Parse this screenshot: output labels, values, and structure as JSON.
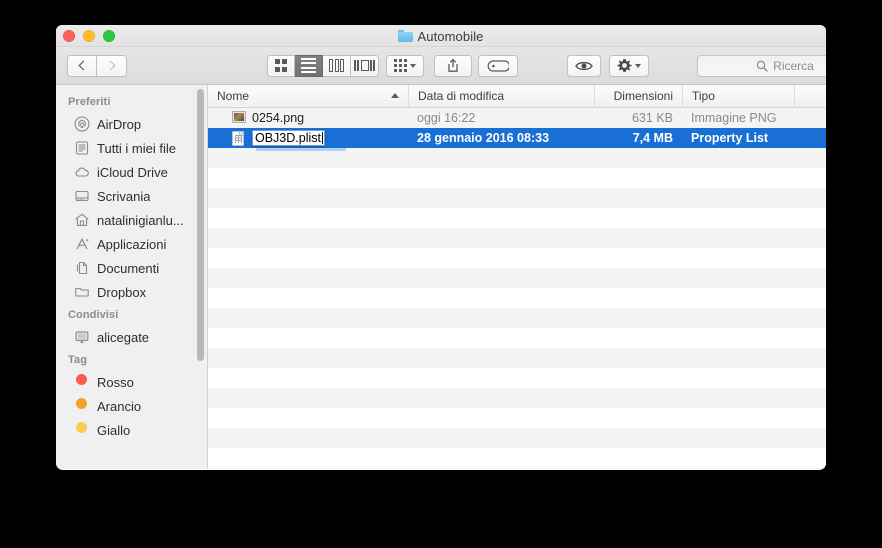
{
  "window": {
    "title": "Automobile",
    "title_icon": "folder-icon",
    "traffic_lights": [
      {
        "name": "close",
        "color": "#ff5f57"
      },
      {
        "name": "minimize",
        "color": "#febc2e"
      },
      {
        "name": "maximize",
        "color": "#28c840"
      }
    ]
  },
  "toolbar": {
    "back_icon": "chevron-left-icon",
    "forward_icon": "chevron-right-icon",
    "view_modes": [
      {
        "name": "icon-view",
        "icon": "grid-icon",
        "active": false
      },
      {
        "name": "list-view",
        "icon": "list-icon",
        "active": true
      },
      {
        "name": "column-view",
        "icon": "columns-icon",
        "active": false
      },
      {
        "name": "cover-flow-view",
        "icon": "coverflow-icon",
        "active": false
      }
    ],
    "arrange_icon": "arrange-grid-icon",
    "arrange_caret_icon": "chevron-down-icon",
    "share_icon": "share-icon",
    "tag_icon": "tag-icon",
    "quicklook_icon": "eye-icon",
    "action_icon": "gear-icon",
    "action_caret_icon": "chevron-down-icon"
  },
  "search": {
    "icon": "search-icon",
    "placeholder": "Ricerca",
    "value": ""
  },
  "sidebar": {
    "sections": [
      {
        "heading": "Preferiti",
        "items": [
          {
            "label": "AirDrop",
            "icon": "airdrop-icon"
          },
          {
            "label": "Tutti i miei file",
            "icon": "all-my-files-icon"
          },
          {
            "label": "iCloud Drive",
            "icon": "icloud-icon"
          },
          {
            "label": "Scrivania",
            "icon": "desktop-icon"
          },
          {
            "label": "natalinigianlu...",
            "icon": "home-icon"
          },
          {
            "label": "Applicazioni",
            "icon": "applications-icon"
          },
          {
            "label": "Documenti",
            "icon": "documents-icon"
          },
          {
            "label": "Dropbox",
            "icon": "folder-icon"
          }
        ]
      },
      {
        "heading": "Condivisi",
        "items": [
          {
            "label": "alicegate",
            "icon": "display-icon"
          }
        ]
      },
      {
        "heading": "Tag",
        "items": [
          {
            "label": "Rosso",
            "icon": "tag-dot-icon",
            "color": "#fa5d55"
          },
          {
            "label": "Arancio",
            "icon": "tag-dot-icon",
            "color": "#f6a02d"
          },
          {
            "label": "Giallo",
            "icon": "tag-dot-icon",
            "color": "#f7ce4b"
          }
        ]
      }
    ]
  },
  "filelist": {
    "columns": [
      {
        "key": "name",
        "label": "Nome",
        "sorted": true,
        "sort_dir": "asc"
      },
      {
        "key": "date",
        "label": "Data di modifica"
      },
      {
        "key": "size",
        "label": "Dimensioni"
      },
      {
        "key": "type",
        "label": "Tipo"
      }
    ],
    "rows": [
      {
        "name": "0254.png",
        "date": "oggi 16:22",
        "size": "631 KB",
        "type": "Immagine PNG",
        "icon": "png-file-icon",
        "selected": false,
        "editing": false
      },
      {
        "name": "OBJ3D.plist",
        "date": "28 gennaio 2016 08:33",
        "size": "7,4 MB",
        "type": "Property List",
        "icon": "plist-file-icon",
        "selected": true,
        "editing": true
      }
    ],
    "empty_row_count": 16
  },
  "colors": {
    "selection": "#1a6fd4",
    "stripe": "#f4f4f4",
    "sidebar_bg": "#f0f0f0"
  }
}
